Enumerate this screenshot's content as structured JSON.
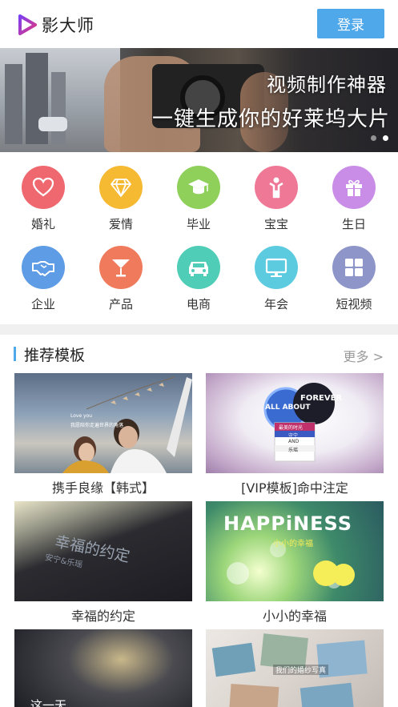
{
  "header": {
    "app_name": "影大师",
    "login_label": "登录"
  },
  "banner": {
    "title": "视频制作神器",
    "subtitle": "一键生成你的好莱坞大片",
    "slide_count": 2,
    "active_slide": 2
  },
  "categories": [
    {
      "label": "婚礼",
      "icon": "heart-icon",
      "color": "#f0686f"
    },
    {
      "label": "爱情",
      "icon": "diamond-icon",
      "color": "#f5b932"
    },
    {
      "label": "毕业",
      "icon": "graduation-cap-icon",
      "color": "#8fd05b"
    },
    {
      "label": "宝宝",
      "icon": "baby-icon",
      "color": "#f07897"
    },
    {
      "label": "生日",
      "icon": "gift-icon",
      "color": "#c98de8"
    },
    {
      "label": "企业",
      "icon": "handshake-icon",
      "color": "#5e9ce5"
    },
    {
      "label": "产品",
      "icon": "cocktail-glass-icon",
      "color": "#f07a5c"
    },
    {
      "label": "电商",
      "icon": "car-icon",
      "color": "#4fcdb6"
    },
    {
      "label": "年会",
      "icon": "monitor-icon",
      "color": "#5ccbe0"
    },
    {
      "label": "短视频",
      "icon": "grid-icon",
      "color": "#8e96c9"
    }
  ],
  "section": {
    "title": "推荐模板",
    "more_label": "更多 >"
  },
  "templates": [
    {
      "name": "携手良缘【韩式】",
      "overlay_text": "Love you",
      "overlay_text2": "我愿陪你走遍世界的角落"
    },
    {
      "name": "[VIP模板]命中注定",
      "overlay_text": "ALL ABOUT",
      "overlay_text2": "FOREVER",
      "overlay_text3": "最美的时光",
      "overlay_text4": "守宁",
      "overlay_text5": "AND",
      "overlay_text6": "乐瑶"
    },
    {
      "name": "幸福的约定",
      "overlay_text": "幸福的约定",
      "overlay_text2": "安宁&乐瑶"
    },
    {
      "name": "小小的幸福",
      "overlay_text": "HAPPiNESS",
      "overlay_text2": "小小的幸福"
    },
    {
      "name": "",
      "overlay_text": "这一天"
    },
    {
      "name": "",
      "overlay_text": "我们的婚纱写真"
    }
  ],
  "colors": {
    "accent": "#4ea8ea",
    "divider": "#f0f0f0"
  }
}
